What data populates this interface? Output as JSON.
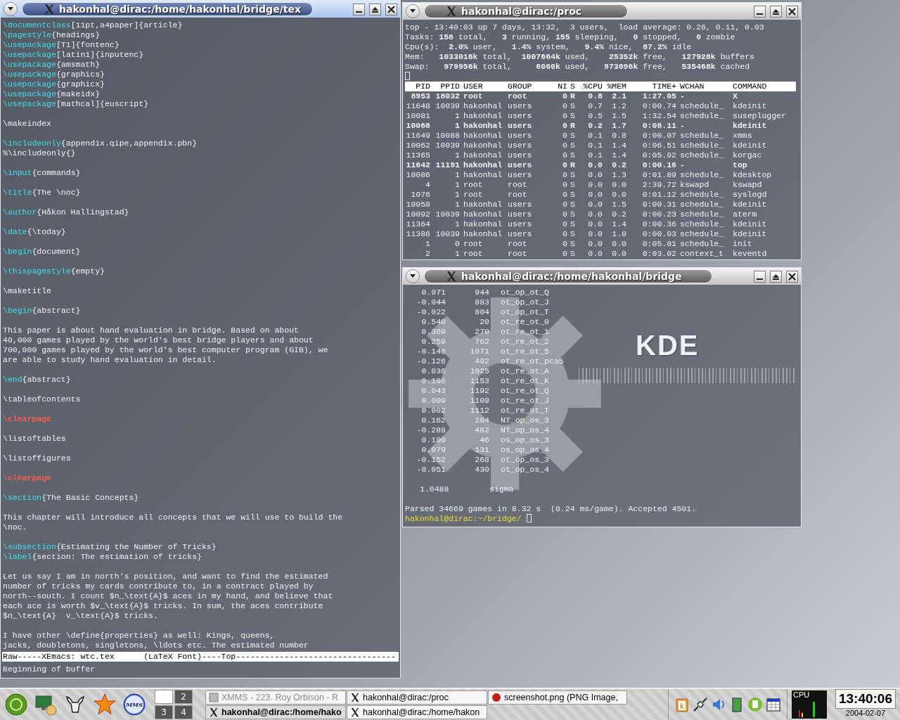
{
  "wallpaper": {
    "logo_text": "KDE"
  },
  "editor_window": {
    "title": "hakonhal@dirac:/home/hakonhal/bridge/tex",
    "active": true,
    "paragraphs": [
      [
        [
          {
            "kind": "command",
            "text": "\\documentclass"
          },
          {
            "kind": "text",
            "text": "[11pt,a4paper]{article}"
          }
        ],
        [
          {
            "kind": "command",
            "text": "\\pagestyle"
          },
          {
            "kind": "text",
            "text": "{headings}"
          }
        ],
        [
          {
            "kind": "command",
            "text": "\\usepackage"
          },
          {
            "kind": "text",
            "text": "[T1]{fontenc}"
          }
        ],
        [
          {
            "kind": "command",
            "text": "\\usepackage"
          },
          {
            "kind": "text",
            "text": "[latin1]{inputenc}"
          }
        ],
        [
          {
            "kind": "command",
            "text": "\\usepackage"
          },
          {
            "kind": "text",
            "text": "{amsmath}"
          }
        ],
        [
          {
            "kind": "command",
            "text": "\\usepackage"
          },
          {
            "kind": "text",
            "text": "{graphics}"
          }
        ],
        [
          {
            "kind": "command",
            "text": "\\usepackage"
          },
          {
            "kind": "text",
            "text": "{graphicx}"
          }
        ],
        [
          {
            "kind": "command",
            "text": "\\usepackage"
          },
          {
            "kind": "text",
            "text": "{makeidx}"
          }
        ],
        [
          {
            "kind": "command",
            "text": "\\usepackage"
          },
          {
            "kind": "text",
            "text": "[mathcal]{euscript}"
          }
        ]
      ],
      [
        [
          {
            "kind": "text",
            "text": "\\makeindex"
          }
        ]
      ],
      [
        [
          {
            "kind": "command",
            "text": "\\includeonly"
          },
          {
            "kind": "text",
            "text": "{appendix.qipe,appendix.pbn}"
          }
        ],
        [
          {
            "kind": "text",
            "text": "%\\includeonly{}"
          }
        ]
      ],
      [
        [
          {
            "kind": "command",
            "text": "\\input"
          },
          {
            "kind": "text",
            "text": "{commands}"
          }
        ]
      ],
      [
        [
          {
            "kind": "command",
            "text": "\\title"
          },
          {
            "kind": "text",
            "text": "{The \\noc}"
          }
        ]
      ],
      [
        [
          {
            "kind": "command",
            "text": "\\author"
          },
          {
            "kind": "text",
            "text": "{Håkon Hallingstad}"
          }
        ]
      ],
      [
        [
          {
            "kind": "command",
            "text": "\\date"
          },
          {
            "kind": "text",
            "text": "{\\today}"
          }
        ]
      ],
      [
        [
          {
            "kind": "command",
            "text": "\\begin"
          },
          {
            "kind": "text",
            "text": "{document}"
          }
        ]
      ],
      [
        [
          {
            "kind": "command",
            "text": "\\thispagestyle"
          },
          {
            "kind": "text",
            "text": "{empty}"
          }
        ]
      ],
      [
        [
          {
            "kind": "text",
            "text": "\\maketitle"
          }
        ]
      ],
      [
        [
          {
            "kind": "command",
            "text": "\\begin"
          },
          {
            "kind": "text",
            "text": "{abstract}"
          }
        ]
      ],
      [
        [
          {
            "kind": "text",
            "text": "This paper is about hand evaluation in bridge. Based on about"
          }
        ],
        [
          {
            "kind": "text",
            "text": "40,000 games played by the world's best bridge players and about"
          }
        ],
        [
          {
            "kind": "text",
            "text": "700,000 games played by the world's best computer program (GIB), we"
          }
        ],
        [
          {
            "kind": "text",
            "text": "are able to study hand evaluation in detail."
          }
        ]
      ],
      [
        [
          {
            "kind": "command",
            "text": "\\end"
          },
          {
            "kind": "text",
            "text": "{abstract}"
          }
        ]
      ],
      [
        [
          {
            "kind": "text",
            "text": "\\tableofcontents"
          }
        ]
      ],
      [
        [
          {
            "kind": "warning",
            "text": "\\clearpage"
          }
        ]
      ],
      [
        [
          {
            "kind": "text",
            "text": "\\listoftables"
          }
        ]
      ],
      [
        [
          {
            "kind": "text",
            "text": "\\listoffigures"
          }
        ]
      ],
      [
        [
          {
            "kind": "warning",
            "text": "\\clearpage"
          }
        ]
      ],
      [
        [
          {
            "kind": "command",
            "text": "\\section"
          },
          {
            "kind": "text",
            "text": "{The Basic Concepts}"
          }
        ]
      ],
      [
        [
          {
            "kind": "text",
            "text": "This chapter will introduce all concepts that we will use to build the"
          }
        ],
        [
          {
            "kind": "text",
            "text": "\\noc."
          }
        ]
      ],
      [
        [
          {
            "kind": "command",
            "text": "\\subsection"
          },
          {
            "kind": "text",
            "text": "{Estimating the Number of Tricks}"
          }
        ],
        [
          {
            "kind": "command",
            "text": "\\label"
          },
          {
            "kind": "text",
            "text": "{section: The estimation of tricks}"
          }
        ]
      ],
      [
        [
          {
            "kind": "text",
            "text": "Let us say I am in north's position, and want to find the estimated"
          }
        ],
        [
          {
            "kind": "text",
            "text": "number of tricks my cards contribute to, in a contract played by"
          }
        ],
        [
          {
            "kind": "text",
            "text": "north--south. I count $n_\\text{A}$ aces in my hand, and believe that"
          }
        ],
        [
          {
            "kind": "text",
            "text": "each ace is worth $v_\\text{A}$ tricks. In sum, the aces contribute"
          }
        ],
        [
          {
            "kind": "text",
            "text": "$n_\\text{A}  v_\\text{A}$ tricks."
          }
        ]
      ],
      [
        [
          {
            "kind": "text",
            "text": "I have other \\define{properties} as well: Kings, queens,"
          }
        ],
        [
          {
            "kind": "text",
            "text": "jacks, doubletons, singletons, \\ldots etc. The estimated number"
          }
        ]
      ]
    ],
    "mode_line": "Raw-----XEmacs: wtc.tex      (LaTeX Font)----Top---------------------------------",
    "echo_area": "Beginning of buffer"
  },
  "top_window": {
    "title": "hakonhal@dirac:/proc",
    "active": false,
    "summary": [
      "top - 13:40:03 up 7 days, 13:32,  3 users,  load average: 0.26, 0.11, 0.03",
      "Tasks: **158** total,   **3** running, **155** sleeping,   **0** stopped,   **0** zombie",
      "Cpu(s):  **2.0%** user,   **1.4%** system,   **9.4%** nice,  **87.2%** idle",
      "Mem:   **1033016k** total,  **1007664k** used,    **25352k** free,   **127928k** buffers",
      "Swap:   **979956k** total,     **6060k** used,   **973896k** free,   **535468k** cached"
    ],
    "columns": [
      "PID",
      "PPID",
      "USER",
      "GROUP",
      "NI",
      "S",
      "%CPU",
      "%MEM",
      "TIME+",
      "WCHAN",
      "COMMAND"
    ],
    "rows": [
      {
        "cells": [
          "8953",
          "18032",
          "root",
          "root",
          "0",
          "R",
          "0.8",
          "2.1",
          "1:27.05",
          "-",
          "X"
        ],
        "running": true
      },
      {
        "cells": [
          "11648",
          "10039",
          "hakonhal",
          "users",
          "0",
          "S",
          "0.7",
          "1.2",
          "0:00.74",
          "schedule_",
          "kdeinit"
        ],
        "running": false
      },
      {
        "cells": [
          "10081",
          "1",
          "hakonhal",
          "users",
          "0",
          "S",
          "0.5",
          "1.5",
          "1:32.54",
          "schedule_",
          "suseplugger"
        ],
        "running": false
      },
      {
        "cells": [
          "10068",
          "1",
          "hakonhal",
          "users",
          "0",
          "R",
          "0.2",
          "1.7",
          "0:08.11",
          "-",
          "kdeinit"
        ],
        "running": true
      },
      {
        "cells": [
          "11649",
          "10088",
          "hakonhal",
          "users",
          "0",
          "S",
          "0.1",
          "0.8",
          "0:00.07",
          "schedule_",
          "xmms"
        ],
        "running": false
      },
      {
        "cells": [
          "10062",
          "10039",
          "hakonhal",
          "users",
          "0",
          "S",
          "0.1",
          "1.4",
          "0:06.51",
          "schedule_",
          "kdeinit"
        ],
        "running": false
      },
      {
        "cells": [
          "11365",
          "1",
          "hakonhal",
          "users",
          "0",
          "S",
          "0.1",
          "1.4",
          "0:05.92",
          "schedule_",
          "korgac"
        ],
        "running": false
      },
      {
        "cells": [
          "11642",
          "11191",
          "hakonhal",
          "users",
          "0",
          "R",
          "0.0",
          "0.2",
          "0:00.16",
          "-",
          "top"
        ],
        "running": true
      },
      {
        "cells": [
          "10086",
          "1",
          "hakonhal",
          "users",
          "0",
          "S",
          "0.0",
          "1.3",
          "0:01.89",
          "schedule_",
          "kdesktop"
        ],
        "running": false
      },
      {
        "cells": [
          "4",
          "1",
          "root",
          "root",
          "0",
          "S",
          "0.0",
          "0.0",
          "2:39.72",
          "kswapd",
          "kswapd"
        ],
        "running": false
      },
      {
        "cells": [
          "1076",
          "1",
          "root",
          "root",
          "0",
          "S",
          "0.0",
          "0.0",
          "0:01.12",
          "schedule_",
          "syslogd"
        ],
        "running": false
      },
      {
        "cells": [
          "10058",
          "1",
          "hakonhal",
          "users",
          "0",
          "S",
          "0.0",
          "1.5",
          "0:00.31",
          "schedule_",
          "kdeinit"
        ],
        "running": false
      },
      {
        "cells": [
          "10092",
          "10039",
          "hakonhal",
          "users",
          "0",
          "S",
          "0.0",
          "0.2",
          "0:00.23",
          "schedule_",
          "aterm"
        ],
        "running": false
      },
      {
        "cells": [
          "11364",
          "1",
          "hakonhal",
          "users",
          "0",
          "S",
          "0.0",
          "1.4",
          "0:00.36",
          "schedule_",
          "kdeinit"
        ],
        "running": false
      },
      {
        "cells": [
          "11386",
          "10039",
          "hakonhal",
          "users",
          "0",
          "S",
          "0.0",
          "1.0",
          "0:00.03",
          "schedule_",
          "kdeinit"
        ],
        "running": false
      },
      {
        "cells": [
          "1",
          "0",
          "root",
          "root",
          "0",
          "S",
          "0.0",
          "0.0",
          "0:05.01",
          "schedule_",
          "init"
        ],
        "running": false
      },
      {
        "cells": [
          "2",
          "1",
          "root",
          "root",
          "0",
          "S",
          "0.0",
          "0.0",
          "0:03.02",
          "context_t",
          "keventd"
        ],
        "running": false
      }
    ]
  },
  "bridge_window": {
    "title": "hakonhal@dirac:/home/hakonhal/bridge",
    "active": false,
    "rows": [
      [
        "0.071",
        "944",
        "ot_op_ot_Q"
      ],
      [
        "-0.044",
        "883",
        "ot_op_ot_J"
      ],
      [
        "-0.022",
        "804",
        "ot_op_ot_T"
      ],
      [
        "0.540",
        "20",
        "ot_re_ot_0"
      ],
      [
        "0.369",
        "270",
        "ot_re_ot_1"
      ],
      [
        "0.259",
        "762",
        "ot_re_ot_2"
      ],
      [
        "-0.146",
        "1071",
        "ot_re_ot_5"
      ],
      [
        "-0.126",
        "492",
        "ot_re_ot_pca5"
      ],
      [
        "0.036",
        "1025",
        "ot_re_ot_A"
      ],
      [
        "0.106",
        "1153",
        "ot_re_ot_K"
      ],
      [
        "0.043",
        "1192",
        "ot_re_ot_Q"
      ],
      [
        "0.009",
        "1109",
        "ot_re_ot_J"
      ],
      [
        "0.002",
        "1112",
        "ot_re_ot_T"
      ],
      [
        "0.162",
        "204",
        "NT_op_os_3"
      ],
      [
        "-0.289",
        "482",
        "NT_op_os_4"
      ],
      [
        "0.100",
        "46",
        "os_op_os_3"
      ],
      [
        "0.079",
        "131",
        "os_op_os_4"
      ],
      [
        "-0.152",
        "268",
        "ot_op_os_3"
      ],
      [
        "-0.051",
        "430",
        "ot_op_os_4"
      ]
    ],
    "sigma_value": "1.0488",
    "sigma_label": "sigma",
    "summary": "Parsed 34669 games in 8.32 s  (0.24 ms/game). Accepted 4501.",
    "prompt": "hakonhal@dirac:~/bridge/"
  },
  "taskbar": {
    "launchers": [
      {
        "kind": "disc"
      },
      {
        "kind": "monitor"
      },
      {
        "kind": "gnu"
      },
      {
        "kind": "star"
      },
      {
        "kind": "media",
        "text": "MMS"
      }
    ],
    "desktops": [
      {
        "selected": true
      },
      {
        "label": "2",
        "selected": false
      },
      {
        "label": "3",
        "selected": false
      },
      {
        "label": "4",
        "selected": false
      }
    ],
    "tasks": [
      {
        "label": "XMMS - 223. Roy Orbison - R",
        "kind": "media",
        "minimized": true,
        "selected": false
      },
      {
        "label": "hakonhal@dirac:/proc",
        "kind": "x",
        "minimized": false,
        "selected": false
      },
      {
        "label": "screenshot.png (PNG Image,",
        "kind": "browser",
        "minimized": false,
        "selected": false
      },
      {
        "label": "hakonhal@dirac:/home/hako",
        "kind": "x",
        "minimized": false,
        "selected": true
      },
      {
        "label": "hakonhal@dirac:/home/hakon",
        "kind": "x",
        "minimized": false,
        "selected": false
      }
    ],
    "tray": [
      {
        "kind": "clipboard",
        "text": "k"
      },
      {
        "kind": "plug"
      },
      {
        "kind": "speaker"
      },
      {
        "kind": "card"
      },
      {
        "kind": "document"
      },
      {
        "kind": "calendar"
      }
    ],
    "cpu_label": "CPU",
    "clock": "13:40:06",
    "date": "2004-02-07"
  }
}
